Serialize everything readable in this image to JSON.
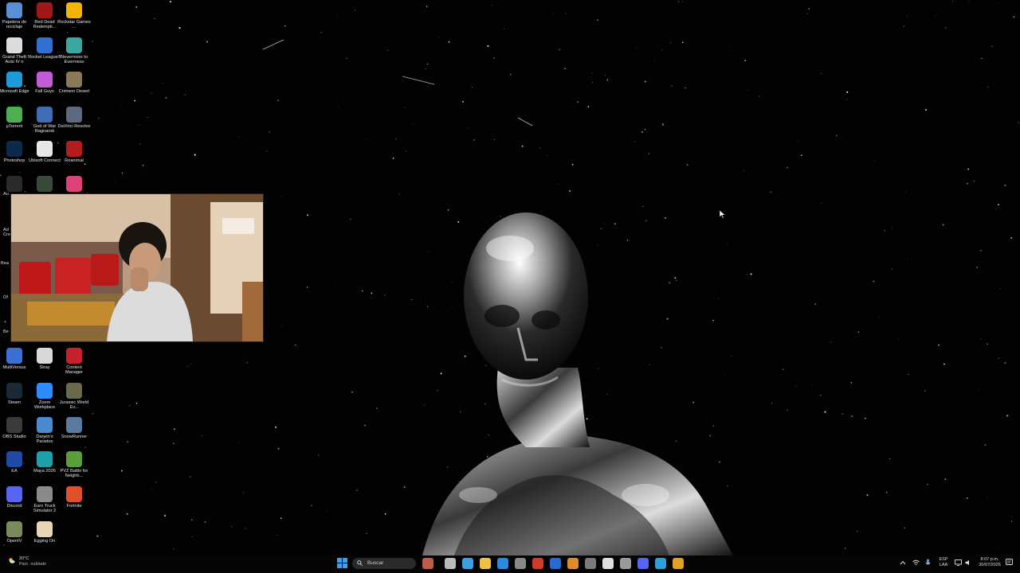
{
  "desktop": {
    "icons": [
      {
        "label": "Papelera de reciclaje",
        "icon": "recycle-bin-icon",
        "color": "#5a8fd6"
      },
      {
        "label": "Red Dead Redempti...",
        "icon": "red-dead-icon",
        "color": "#a01818"
      },
      {
        "label": "Rockstar Games ...",
        "icon": "rockstar-icon",
        "color": "#f2b600"
      },
      {
        "label": "Grand Theft Auto IV n",
        "icon": "gta-iv-icon",
        "color": "#dcdcdc"
      },
      {
        "label": "Rocket League®",
        "icon": "rocket-league-icon",
        "color": "#2f6fd0"
      },
      {
        "label": "Nevermore to Evermess",
        "icon": "nevermore-icon",
        "color": "#3aa8a0"
      },
      {
        "label": "Microsoft Edge",
        "icon": "edge-icon",
        "color": "#1d9bd8"
      },
      {
        "label": "Fall Guys",
        "icon": "fall-guys-icon",
        "color": "#c25bd6"
      },
      {
        "label": "Crimson Desert",
        "icon": "crimson-desert-icon",
        "color": "#8a7a5a"
      },
      {
        "label": "µTorrent",
        "icon": "utorrent-icon",
        "color": "#4caf50"
      },
      {
        "label": "God of War Ragnarok",
        "icon": "god-of-war-icon",
        "color": "#3f6db5"
      },
      {
        "label": "DaVinci Resolve",
        "icon": "davinci-icon",
        "color": "#5b6b7d"
      },
      {
        "label": "Photoshop",
        "icon": "photoshop-icon",
        "color": "#0e2a4a"
      },
      {
        "label": "Ubisoft Connect",
        "icon": "ubisoft-icon",
        "color": "#e8e8e8"
      },
      {
        "label": "Reanimal",
        "icon": "reanimal-icon",
        "color": "#b31d1d"
      },
      {
        "label": "",
        "icon": "adobe-icon",
        "color": "#2a2a2a"
      },
      {
        "label": "",
        "icon": "app-icon",
        "color": "#3a4a3a"
      },
      {
        "label": "",
        "icon": "app-pink-icon",
        "color": "#e0407a"
      },
      {
        "label": "MultiVersus",
        "icon": "multiversus-icon",
        "color": "#3b6fd1"
      },
      {
        "label": "Stray",
        "icon": "stray-icon",
        "color": "#d8d8d8"
      },
      {
        "label": "Content Manager",
        "icon": "content-manager-icon",
        "color": "#c8202a"
      },
      {
        "label": "Steam",
        "icon": "steam-icon",
        "color": "#1b2838"
      },
      {
        "label": "Zoom Workplace",
        "icon": "zoom-icon",
        "color": "#2d8cff"
      },
      {
        "label": "Jurassic World Ev...",
        "icon": "jurassic-icon",
        "color": "#6a6a4a"
      },
      {
        "label": "OBS Studio",
        "icon": "obs-icon",
        "color": "#3a3a3a"
      },
      {
        "label": "Darwin's Paradox",
        "icon": "darwins-icon",
        "color": "#4a8ad0"
      },
      {
        "label": "SnowRunner",
        "icon": "snowrunner-icon",
        "color": "#5a7aa0"
      },
      {
        "label": "EA",
        "icon": "ea-icon",
        "color": "#1f4aa8"
      },
      {
        "label": "Maya 2026",
        "icon": "maya-icon",
        "color": "#1ba1a8"
      },
      {
        "label": "PVZ Battle for Neighb...",
        "icon": "pvz-icon",
        "color": "#5aa03a"
      },
      {
        "label": "Discord",
        "icon": "discord-icon",
        "color": "#5865f2"
      },
      {
        "label": "Euro Truck Simulator 2",
        "icon": "euro-truck-icon",
        "color": "#8a8a8a"
      },
      {
        "label": "Fortnite",
        "icon": "fortnite-icon",
        "color": "#e0502a"
      },
      {
        "label": "OpenIV",
        "icon": "openiv-icon",
        "color": "#7a8a5a"
      },
      {
        "label": "Egging On",
        "icon": "egging-on-icon",
        "color": "#e8d8b8"
      }
    ],
    "partial_labels": [
      "Au",
      "Ad Cre",
      "Bea",
      "Of",
      "Be"
    ]
  },
  "taskbar": {
    "weather": {
      "temp": "20°C",
      "desc": "Parc. nublado",
      "icon": "weather-cloud-icon"
    },
    "search_placeholder": "Buscar",
    "start_icon": "windows-start-icon",
    "apps": [
      {
        "icon": "widget-icon",
        "color": "#c05a4a"
      },
      {
        "icon": "task-view-icon",
        "color": "#bbbbbb"
      },
      {
        "icon": "copilot-icon",
        "color": "#3aa0e0"
      },
      {
        "icon": "file-explorer-icon",
        "color": "#f0c040"
      },
      {
        "icon": "ms-store-icon",
        "color": "#2a8ae0"
      },
      {
        "icon": "settings-icon",
        "color": "#888888"
      },
      {
        "icon": "app-red-icon",
        "color": "#d03a2a"
      },
      {
        "icon": "photoshop-taskbar-icon",
        "color": "#2a6ad0"
      },
      {
        "icon": "illustrator-icon",
        "color": "#e08a2a"
      },
      {
        "icon": "app-gray-icon",
        "color": "#7a7a7a"
      },
      {
        "icon": "notepad-icon",
        "color": "#e0e0e0"
      },
      {
        "icon": "gear-taskbar-icon",
        "color": "#9a9a9a"
      },
      {
        "icon": "discord-taskbar-icon",
        "color": "#5865f2"
      },
      {
        "icon": "edge-taskbar-icon",
        "color": "#2aa0d8"
      },
      {
        "icon": "chrome-icon",
        "color": "#e0a020"
      }
    ],
    "tray": {
      "lang": "ESP",
      "region": "LAA",
      "time": "8:07 p.m.",
      "date": "30/07/2026"
    }
  }
}
